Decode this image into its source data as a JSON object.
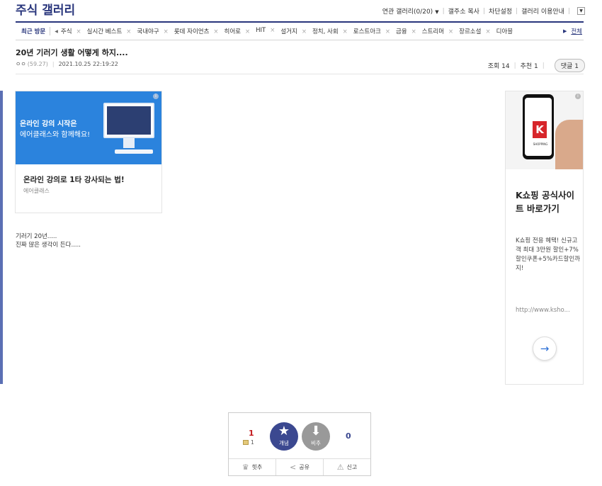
{
  "header": {
    "gallery_title": "주식 갤러리",
    "related_gallery": "연관 갤러리(0/20)",
    "copy_address": "갤주소 복사",
    "block_settings": "차단설정",
    "gallery_guide": "갤러리 이용안내"
  },
  "recent": {
    "label": "최근 방문",
    "items": [
      "주식",
      "실시간 베스트",
      "국내야구",
      "롯데 자이언츠",
      "히어로",
      "HIT",
      "설거지",
      "정치, 사회",
      "로스트아크",
      "금융",
      "스트리머",
      "장르소설",
      "디아블"
    ],
    "all_label": "전체"
  },
  "post": {
    "title": "20년 기러기 생활 어떻게 하지....",
    "author": "ㅇㅇ",
    "ip": "(59.27)",
    "date": "2021.10.25 22:19:22",
    "views_label": "조회 14",
    "recommend_label": "추천 1",
    "reply_label": "댓글 1",
    "body_line1": "기러기 20년.....",
    "body_line2": "진짜 많은 생각이 든다....."
  },
  "ad_left": {
    "image_line1": "온라인 강의 시작은",
    "image_line2": "에어클래스와 함께해요!",
    "headline": "온라인 강의로 1타 강사되는 법!",
    "brand": "에어클래스",
    "info": "i"
  },
  "ad_right": {
    "logo_letter": "K",
    "logo_text": "SHOPPING",
    "title": "K쇼핑 공식사이트 바로가기",
    "description": "K쇼핑 전용 혜택! 신규고객 최대 3만원 할인+7%할인쿠폰+5%카드할인까지!",
    "url": "http://www.ksho...",
    "arrow": "→",
    "info": "i"
  },
  "vote": {
    "up_count": "1",
    "fix_count": "1",
    "up_label": "개념",
    "down_label": "비추",
    "down_count": "0",
    "hit_label": "힛추",
    "share_label": "공유",
    "report_label": "신고"
  },
  "colors": {
    "brand_navy": "#29367c",
    "vote_up": "#3b4890",
    "up_count_red": "#c3191c",
    "ad_blue": "#2b83dd",
    "k_red": "#d7262b"
  },
  "icons": {
    "up": "star-icon",
    "down": "arrow-down-icon",
    "hit": "crown-icon",
    "share": "share-icon",
    "report": "siren-icon"
  }
}
